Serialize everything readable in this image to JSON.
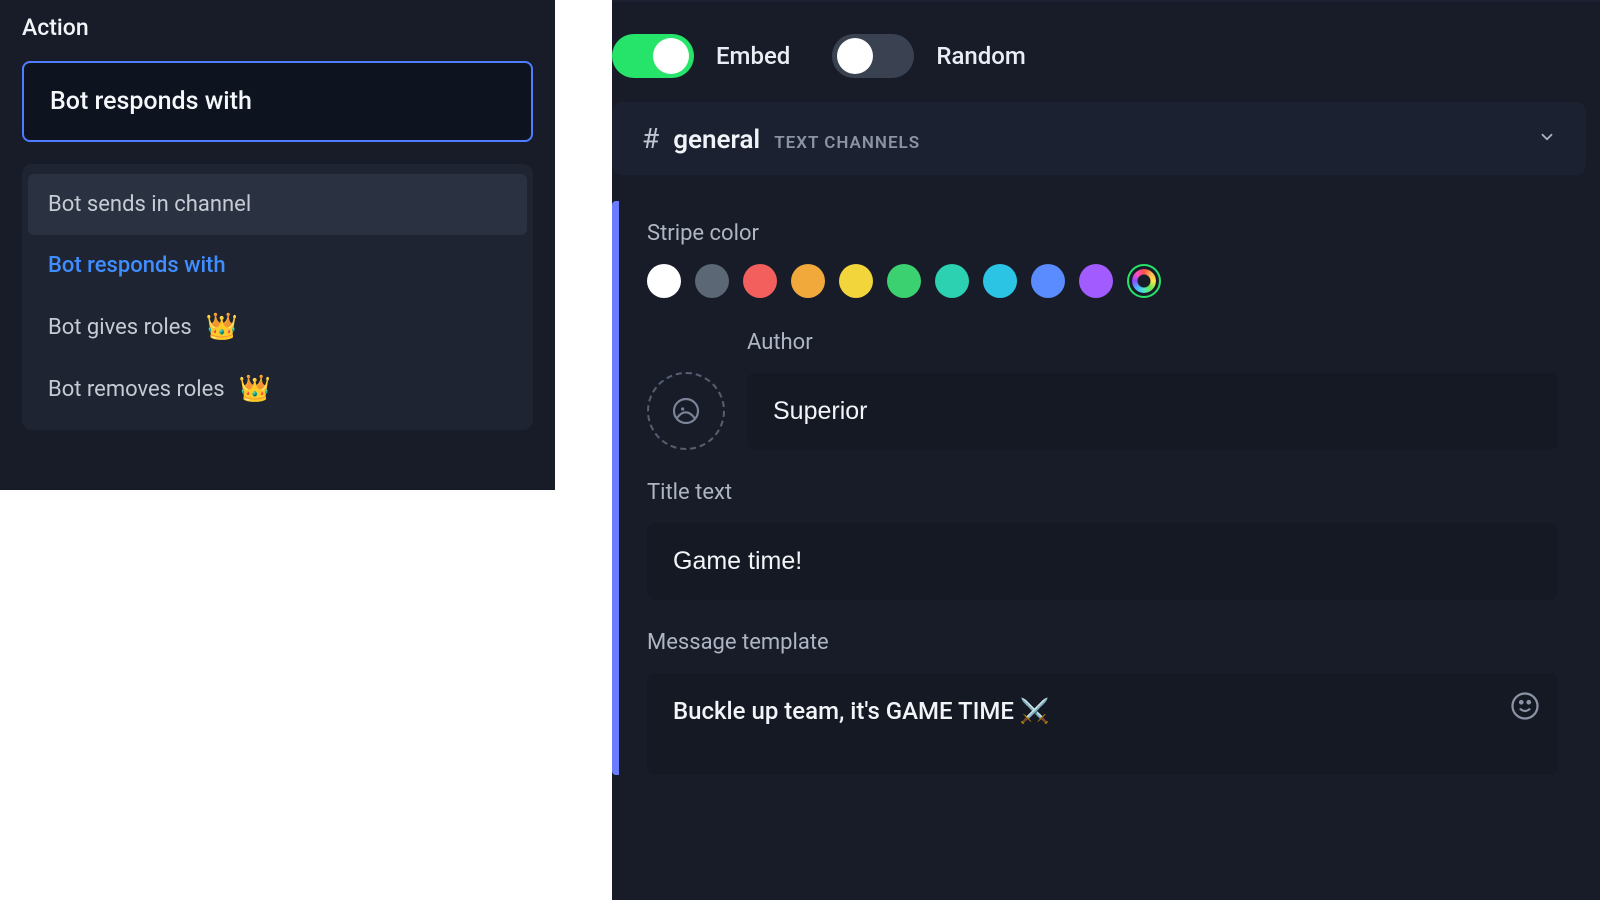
{
  "left": {
    "section_title": "Action",
    "selected_action": "Bot responds with",
    "options": [
      {
        "label": "Bot sends in channel",
        "premium": false,
        "highlighted": true,
        "selected": false
      },
      {
        "label": "Bot responds with",
        "premium": false,
        "highlighted": false,
        "selected": true
      },
      {
        "label": "Bot gives roles",
        "premium": true,
        "highlighted": false,
        "selected": false
      },
      {
        "label": "Bot removes roles",
        "premium": true,
        "highlighted": false,
        "selected": false
      }
    ]
  },
  "right": {
    "toggles": {
      "embed": {
        "label": "Embed",
        "on": true
      },
      "random": {
        "label": "Random",
        "on": false
      }
    },
    "channel": {
      "name": "general",
      "caption": "TEXT CHANNELS"
    },
    "stripe": {
      "label": "Stripe color",
      "colors": [
        "#ffffff",
        "#5b6775",
        "#f25f5c",
        "#f2a93b",
        "#f2d43b",
        "#3bd170",
        "#2bd1b0",
        "#2bc4e5",
        "#5a8cff",
        "#a15bff"
      ]
    },
    "author": {
      "label": "Author",
      "value": "Superior"
    },
    "title": {
      "label": "Title text",
      "value": "Game time!"
    },
    "message": {
      "label": "Message template",
      "value": "Buckle up team, it's GAME TIME ⚔️"
    }
  }
}
